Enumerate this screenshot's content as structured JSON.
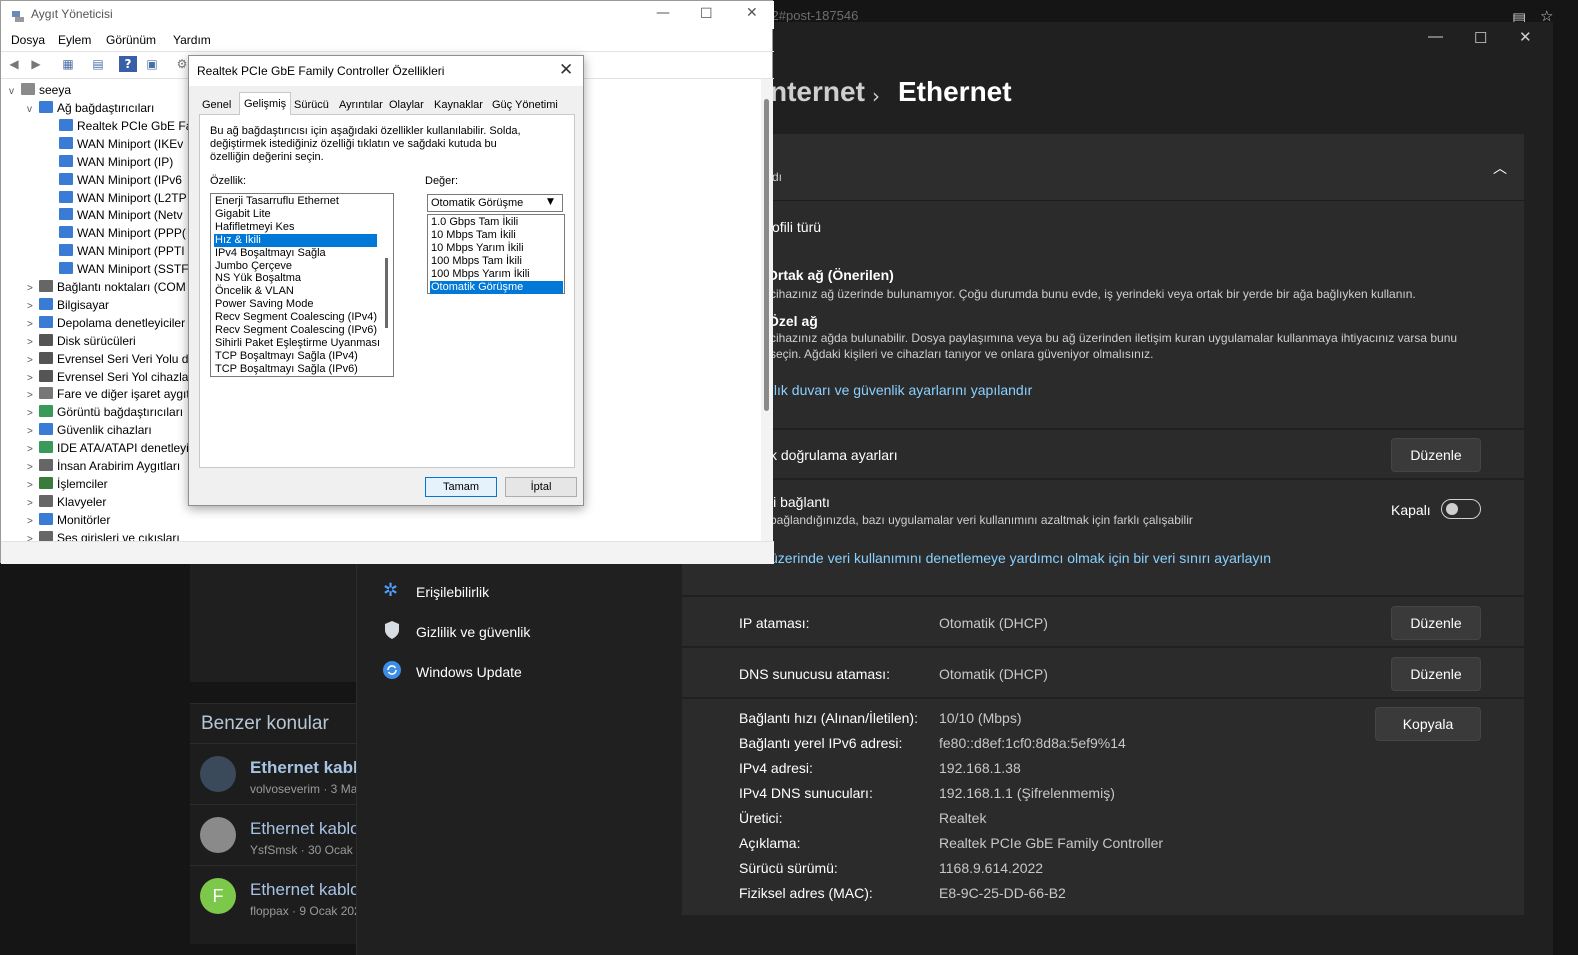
{
  "browser": {
    "url_fragment": "e-2#post-187546"
  },
  "forum": {
    "similar_title": "Benzer konular",
    "threads": [
      {
        "title": "Ethernet kabl",
        "meta": "volvoseverim · 3 Ma",
        "avatar_color": "#3a4a5a",
        "avatar_letter": ""
      },
      {
        "title": "Ethernet kablo",
        "meta": "YsfSmsk · 30 Ocak 20",
        "avatar_color": "#8a8a8a",
        "avatar_letter": ""
      },
      {
        "title": "Ethernet kablo",
        "meta": "floppax · 9 Ocak 202",
        "avatar_color": "#7cc84a",
        "avatar_letter": "F"
      }
    ]
  },
  "settings": {
    "breadcrumb_parent": "nternet",
    "breadcrumb_sep": "›",
    "breadcrumb_current": "Ethernet",
    "section_header": "dı",
    "profile_type": "ofili türü",
    "public_title": "Ortak ağ (Önerilen)",
    "public_desc": "cihazınız ağ üzerinde bulunamıyor. Çoğu durumda bunu evde, iş yerindeki veya ortak bir yerde bir ağa bağlıyken kullanın.",
    "private_title": "Özel ağ",
    "private_desc_1": "cihazınız ağda bulunabilir. Dosya paylaşımına veya bu ağ üzerinden iletişim kuran uygulamalar kullanmaya ihtiyacınız varsa bunu",
    "private_desc_2": "seçin. Ağdaki kişileri ve cihazları tanıyor ve onlara güveniyor olmalısınız.",
    "firewall_link": "ılık duvarı ve güvenlik ayarlarını yapılandır",
    "auth_label": "k doğrulama ayarları",
    "edit_label": "Düzenle",
    "metered_title": "li bağlantı",
    "metered_desc": "bağlandığınızda, bazı uygulamalar veri kullanımını azaltmak için farklı çalışabilir",
    "metered_state": "Kapalı",
    "data_limit_link": "üzerinde veri kullanımını denetlemeye yardımcı olmak için bir veri sınırı ayarlayın",
    "ip_label": "IP ataması:",
    "ip_value": "Otomatik (DHCP)",
    "dns_label": "DNS sunucusu ataması:",
    "dns_value": "Otomatik (DHCP)",
    "copy_label": "Kopyala",
    "details": [
      {
        "label": "Bağlantı hızı (Alınan/İletilen):",
        "value": "10/10 (Mbps)"
      },
      {
        "label": "Bağlantı yerel IPv6 adresi:",
        "value": "fe80::d8ef:1cf0:8d8a:5ef9%14"
      },
      {
        "label": "IPv4 adresi:",
        "value": "192.168.1.38"
      },
      {
        "label": "IPv4 DNS sunucuları:",
        "value": "192.168.1.1 (Şifrelenmemiş)"
      },
      {
        "label": "Üretici:",
        "value": "Realtek"
      },
      {
        "label": "Açıklama:",
        "value": "Realtek PCIe GbE Family Controller"
      },
      {
        "label": "Sürücü sürümü:",
        "value": "1168.9.614.2022"
      },
      {
        "label": "Fiziksel adres (MAC):",
        "value": "E8-9C-25-DD-66-B2"
      }
    ],
    "nav": [
      {
        "label": "Erişilebilirlik",
        "icon": "accessibility-icon",
        "color": "#4ea3ff"
      },
      {
        "label": "Gizlilik ve güvenlik",
        "icon": "shield-icon",
        "color": "#cfd6dc"
      },
      {
        "label": "Windows Update",
        "icon": "update-icon",
        "color": "#4ea3ff"
      }
    ]
  },
  "devmgr": {
    "title": "Aygıt Yöneticisi",
    "menu": [
      "Dosya",
      "Eylem",
      "Görünüm",
      "Yardım"
    ],
    "tree_root": "seeya",
    "tree": [
      {
        "label": "Ağ bağdaştırıcıları",
        "level": 1,
        "expander": "v",
        "icon_color": "#3a7bd5"
      },
      {
        "label": "Realtek PCIe GbE Far",
        "level": 2,
        "expander": "",
        "icon_color": "#3a7bd5"
      },
      {
        "label": "WAN Miniport (IKEv",
        "level": 2,
        "expander": "",
        "icon_color": "#3a7bd5"
      },
      {
        "label": "WAN Miniport (IP)",
        "level": 2,
        "expander": "",
        "icon_color": "#3a7bd5"
      },
      {
        "label": "WAN Miniport (IPv6",
        "level": 2,
        "expander": "",
        "icon_color": "#3a7bd5"
      },
      {
        "label": "WAN Miniport (L2TP",
        "level": 2,
        "expander": "",
        "icon_color": "#3a7bd5"
      },
      {
        "label": "WAN Miniport (Netv",
        "level": 2,
        "expander": "",
        "icon_color": "#3a7bd5"
      },
      {
        "label": "WAN Miniport (PPP(",
        "level": 2,
        "expander": "",
        "icon_color": "#3a7bd5"
      },
      {
        "label": "WAN Miniport (PPTI",
        "level": 2,
        "expander": "",
        "icon_color": "#3a7bd5"
      },
      {
        "label": "WAN Miniport (SSTF",
        "level": 2,
        "expander": "",
        "icon_color": "#3a7bd5"
      },
      {
        "label": "Bağlantı noktaları (COM",
        "level": 1,
        "expander": ">",
        "icon_color": "#666666"
      },
      {
        "label": "Bilgisayar",
        "level": 1,
        "expander": ">",
        "icon_color": "#3a7bd5"
      },
      {
        "label": "Depolama denetleyiciler",
        "level": 1,
        "expander": ">",
        "icon_color": "#3a7bd5"
      },
      {
        "label": "Disk sürücüleri",
        "level": 1,
        "expander": ">",
        "icon_color": "#555555"
      },
      {
        "label": "Evrensel Seri Veri Yolu de",
        "level": 1,
        "expander": ">",
        "icon_color": "#555555"
      },
      {
        "label": "Evrensel Seri Yol cihazlar",
        "level": 1,
        "expander": ">",
        "icon_color": "#555555"
      },
      {
        "label": "Fare ve diğer işaret aygıt",
        "level": 1,
        "expander": ">",
        "icon_color": "#777777"
      },
      {
        "label": "Görüntü bağdaştırıcıları",
        "level": 1,
        "expander": ">",
        "icon_color": "#3a9a5a"
      },
      {
        "label": "Güvenlik cihazları",
        "level": 1,
        "expander": ">",
        "icon_color": "#3a7bd5"
      },
      {
        "label": "IDE ATA/ATAPI denetleyi",
        "level": 1,
        "expander": ">",
        "icon_color": "#3a9a5a"
      },
      {
        "label": "İnsan Arabirim Aygıtları",
        "level": 1,
        "expander": ">",
        "icon_color": "#666666"
      },
      {
        "label": "İşlemciler",
        "level": 1,
        "expander": ">",
        "icon_color": "#3a7a3a"
      },
      {
        "label": "Klavyeler",
        "level": 1,
        "expander": ">",
        "icon_color": "#666666"
      },
      {
        "label": "Monitörler",
        "level": 1,
        "expander": ">",
        "icon_color": "#3a7bd5"
      },
      {
        "label": "Ses girişleri ve çıkışları",
        "level": 1,
        "expander": ">",
        "icon_color": "#666666"
      }
    ]
  },
  "props": {
    "title": "Realtek PCIe GbE Family Controller Özellikleri",
    "tabs": [
      "Genel",
      "Gelişmiş",
      "Sürücü",
      "Ayrıntılar",
      "Olaylar",
      "Kaynaklar",
      "Güç Yönetimi"
    ],
    "active_tab": "Gelişmiş",
    "description": "Bu ağ bağdaştırıcısı için aşağıdaki özellikler kullanılabilir. Solda, değiştirmek istediğiniz özelliği tıklatın ve sağdaki kutuda bu özelliğin değerini seçin.",
    "property_label": "Özellik:",
    "value_label": "Değer:",
    "properties": [
      "Enerji Tasarruflu Ethernet",
      "Gigabit Lite",
      "Hafifletmeyi Kes",
      "Hız & İkili",
      "IPv4 Boşaltmayı Sağla",
      "Jumbo Çerçeve",
      "NS Yük Boşaltma",
      "Öncelik & VLAN",
      "Power Saving Mode",
      "Recv Segment Coalescing (IPv4)",
      "Recv Segment Coalescing (IPv6)",
      "Sihirli Paket Eşleştirme Uyanması",
      "TCP Boşaltmayı Sağla (IPv4)",
      "TCP Boşaltmayı Sağla (IPv6)"
    ],
    "selected_property": "Hız & İkili",
    "value_selected": "Otomatik Görüşme",
    "values": [
      "1.0 Gbps Tam İkili",
      "10 Mbps Tam İkili",
      "10 Mbps Yarım İkili",
      "100 Mbps Tam İkili",
      "100 Mbps Yarım İkili",
      "Otomatik Görüşme"
    ],
    "ok_label": "Tamam",
    "cancel_label": "İptal"
  }
}
